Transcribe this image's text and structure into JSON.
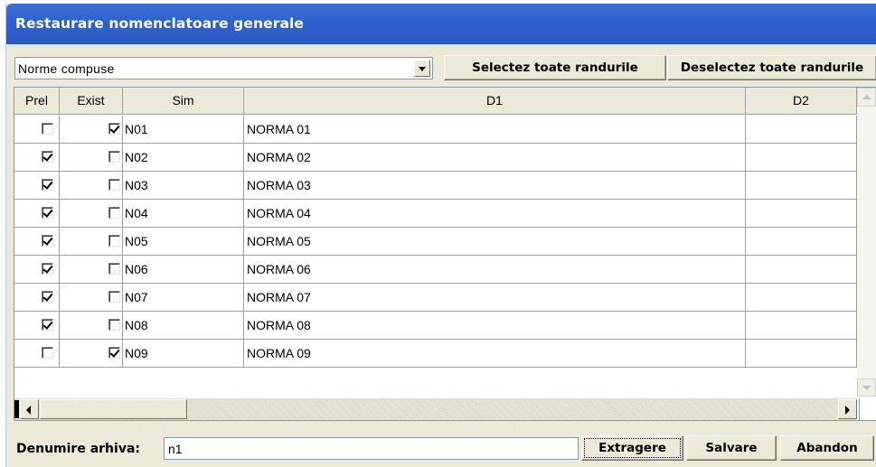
{
  "window": {
    "title": "Restaurare nomenclatoare generale"
  },
  "filter": {
    "selected": "Norme compuse"
  },
  "toolbar": {
    "select_all_label": "Selectez toate randurile",
    "deselect_all_label": "Deselectez toate randurile"
  },
  "grid": {
    "columns": [
      "Prel",
      "Exist",
      "Sim",
      "D1",
      "D2"
    ],
    "rows": [
      {
        "prel": false,
        "exist": true,
        "sim": "N01",
        "d1": "NORMA 01",
        "d2": ""
      },
      {
        "prel": true,
        "exist": false,
        "sim": "N02",
        "d1": "NORMA 02",
        "d2": ""
      },
      {
        "prel": true,
        "exist": false,
        "sim": "N03",
        "d1": "NORMA 03",
        "d2": ""
      },
      {
        "prel": true,
        "exist": false,
        "sim": "N04",
        "d1": "NORMA 04",
        "d2": ""
      },
      {
        "prel": true,
        "exist": false,
        "sim": "N05",
        "d1": "NORMA 05",
        "d2": ""
      },
      {
        "prel": true,
        "exist": false,
        "sim": "N06",
        "d1": "NORMA 06",
        "d2": ""
      },
      {
        "prel": true,
        "exist": false,
        "sim": "N07",
        "d1": "NORMA 07",
        "d2": ""
      },
      {
        "prel": true,
        "exist": false,
        "sim": "N08",
        "d1": "NORMA 08",
        "d2": ""
      },
      {
        "prel": false,
        "exist": true,
        "sim": "N09",
        "d1": "NORMA 09",
        "d2": ""
      }
    ]
  },
  "footer": {
    "archive_label": "Denumire arhiva:",
    "archive_value": "n1",
    "extract_label": "Extragere",
    "save_label": "Salvare",
    "cancel_label": "Abandon"
  },
  "colors": {
    "titlebar": "#2f62cf",
    "window_bg": "#ece9d8"
  }
}
